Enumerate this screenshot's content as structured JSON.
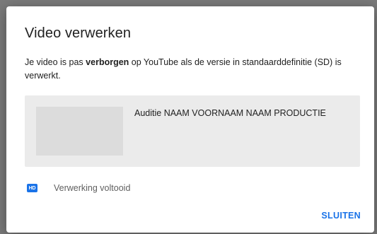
{
  "dialog": {
    "title": "Video verwerken",
    "message": {
      "before": "Je video is pas ",
      "bold": "verborgen",
      "after": " op YouTube als de versie in standaarddefinitie (SD) is verwerkt."
    },
    "video": {
      "title": "Auditie NAAM VOORNAAM NAAM PRODUCTIE"
    },
    "status": {
      "icon": "hd-icon",
      "icon_text": "HD",
      "text": "Verwerking voltooid"
    },
    "close_label": "SLUITEN"
  },
  "colors": {
    "accent": "#1a73e8",
    "card_background": "#ebebeb",
    "thumbnail": "#dcdcdc"
  }
}
